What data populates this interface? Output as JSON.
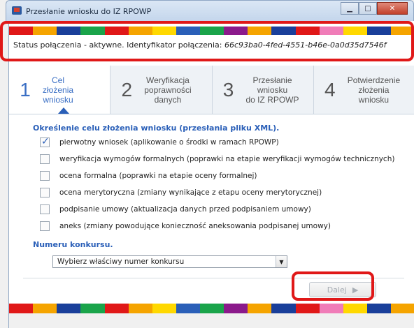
{
  "window": {
    "title": "Przesłanie wniosku do IZ RPOWP",
    "minimize_glyph": "▁",
    "maximize_glyph": "□",
    "close_glyph": "✕"
  },
  "stripe_colors": [
    "#e01818",
    "#f5a400",
    "#1a3f9a",
    "#1aa44a",
    "#e01818",
    "#f5a400",
    "#ffd800",
    "#2a5fb8",
    "#1aa44a",
    "#8b1a8b",
    "#f5a400",
    "#1a3f9a",
    "#e01818",
    "#f07cb8",
    "#ffd800",
    "#1a3f9a",
    "#f5a400"
  ],
  "status": {
    "label": "Status połączenia - aktywne. Identyfikator połączenia:",
    "connection_id": "66c93ba0-4fed-4551-b46e-0a0d35d7546f"
  },
  "steps": [
    {
      "number": "1",
      "label_lines": [
        "Cel",
        "złożenia",
        "wniosku"
      ],
      "active": true
    },
    {
      "number": "2",
      "label_lines": [
        "Weryfikacja",
        "poprawności",
        "danych"
      ],
      "active": false
    },
    {
      "number": "3",
      "label_lines": [
        "Przesłanie",
        "wniosku",
        "do IZ RPOWP"
      ],
      "active": false
    },
    {
      "number": "4",
      "label_lines": [
        "Potwierdzenie",
        "złożenia",
        "wniosku"
      ],
      "active": false
    }
  ],
  "purpose_section": {
    "title": "Określenie celu złożenia wniosku (przesłania pliku XML).",
    "options": [
      {
        "label": "pierwotny wniosek (aplikowanie o środki w ramach RPOWP)",
        "checked": true
      },
      {
        "label": "weryfikacja wymogów formalnych (poprawki na etapie weryfikacji wymogów technicznych)",
        "checked": false
      },
      {
        "label": "ocena formalna (poprawki na etapie oceny formalnej)",
        "checked": false
      },
      {
        "label": "ocena merytoryczna (zmiany wynikające z etapu oceny merytorycznej)",
        "checked": false
      },
      {
        "label": "podpisanie umowy (aktualizacja danych przed podpisaniem umowy)",
        "checked": false
      },
      {
        "label": "aneks (zmiany powodujące konieczność aneksowania podpisanej umowy)",
        "checked": false
      }
    ]
  },
  "contest": {
    "title": "Numeru konkursu.",
    "select_value": "Wybierz właściwy numer konkursu"
  },
  "footer": {
    "next_label": "Dalej",
    "next_enabled": false
  }
}
